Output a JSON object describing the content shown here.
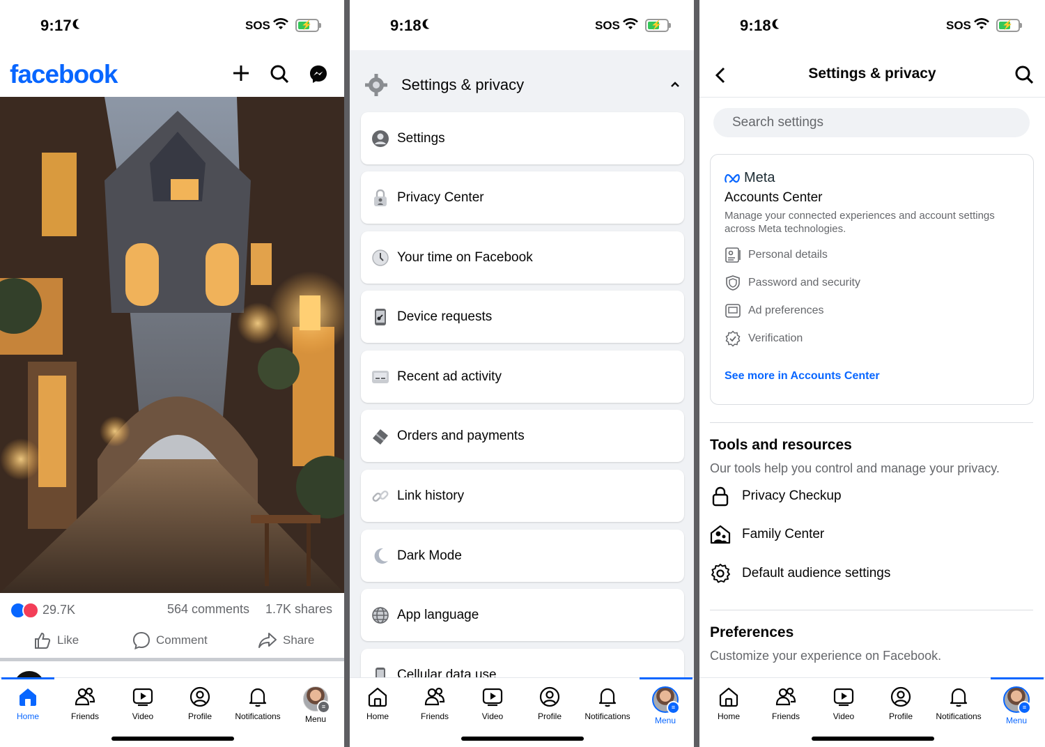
{
  "colors": {
    "brand": "#0866ff",
    "muted": "#65676b",
    "panel_bg": "#f0f2f5",
    "like": "#0866ff",
    "love": "#f33e58"
  },
  "screen1": {
    "status": {
      "time": "9:17",
      "sos": "SOS"
    },
    "header": {
      "logo": "facebook",
      "icons": [
        "plus-icon",
        "search-icon",
        "messenger-icon"
      ]
    },
    "post": {
      "reactions_count": "29.7K",
      "comments": "564 comments",
      "shares": "1.7K shares",
      "actions": {
        "like": "Like",
        "comment": "Comment",
        "share": "Share"
      }
    }
  },
  "screen2": {
    "status": {
      "time": "9:18",
      "sos": "SOS"
    },
    "section_title": "Settings & privacy",
    "items": [
      {
        "label": "Settings",
        "icon": "user-circle-icon"
      },
      {
        "label": "Privacy Center",
        "icon": "lock-person-icon"
      },
      {
        "label": "Your time on Facebook",
        "icon": "clock-icon"
      },
      {
        "label": "Device requests",
        "icon": "phone-key-icon"
      },
      {
        "label": "Recent ad activity",
        "icon": "ad-screen-icon"
      },
      {
        "label": "Orders and payments",
        "icon": "card-icon"
      },
      {
        "label": "Link history",
        "icon": "link-icon"
      },
      {
        "label": "Dark Mode",
        "icon": "moon-icon"
      },
      {
        "label": "App language",
        "icon": "globe-icon"
      },
      {
        "label": "Cellular data use",
        "icon": "phone-icon"
      }
    ]
  },
  "screen3": {
    "status": {
      "time": "9:18",
      "sos": "SOS"
    },
    "title": "Settings & privacy",
    "search_placeholder": "Search settings",
    "accounts_center": {
      "brand": "Meta",
      "title": "Accounts Center",
      "description": "Manage your connected experiences and account settings across Meta technologies.",
      "items": [
        "Personal details",
        "Password and security",
        "Ad preferences",
        "Verification"
      ],
      "link": "See more in Accounts Center"
    },
    "tools": {
      "title": "Tools and resources",
      "subtitle": "Our tools help you control and manage your privacy.",
      "items": [
        "Privacy Checkup",
        "Family Center",
        "Default audience settings"
      ]
    },
    "preferences": {
      "title": "Preferences",
      "subtitle": "Customize your experience on Facebook."
    }
  },
  "tabbar": {
    "tabs": [
      {
        "label": "Home",
        "icon": "home-icon"
      },
      {
        "label": "Friends",
        "icon": "friends-icon"
      },
      {
        "label": "Video",
        "icon": "video-icon"
      },
      {
        "label": "Profile",
        "icon": "profile-icon"
      },
      {
        "label": "Notifications",
        "icon": "bell-icon"
      },
      {
        "label": "Menu",
        "icon": "avatar-menu-icon"
      }
    ],
    "active_screen1": "Home",
    "active_screen2": "Menu",
    "active_screen3": "Menu"
  }
}
